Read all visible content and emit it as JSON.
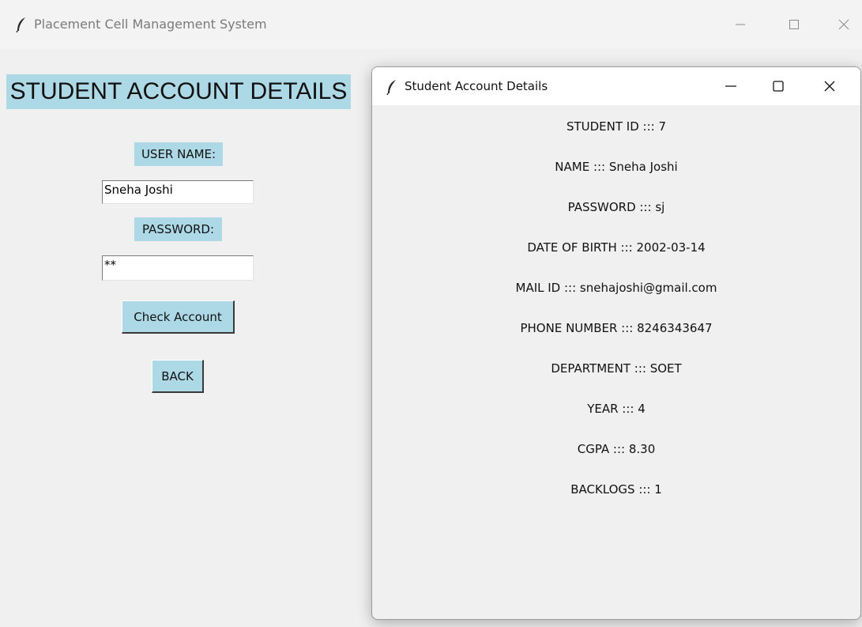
{
  "main_window": {
    "title": "Placement Cell Management System",
    "heading": "STUDENT ACCOUNT DETAILS",
    "username_label": "USER NAME:",
    "username_value": "Sneha Joshi",
    "password_label": "PASSWORD:",
    "password_value": "**",
    "check_account_label": "Check Account",
    "back_label": "BACK"
  },
  "popup_window": {
    "title": "Student Account Details",
    "details": [
      "STUDENT ID ::: 7",
      "NAME ::: Sneha Joshi",
      "PASSWORD ::: sj",
      "DATE OF BIRTH ::: 2002-03-14",
      "MAIL ID ::: snehajoshi@gmail.com",
      "PHONE NUMBER ::: 8246343647",
      "DEPARTMENT ::: SOET",
      "YEAR ::: 4",
      "CGPA ::: 8.30",
      "BACKLOGS ::: 1"
    ]
  },
  "icons": {
    "app": "feather-icon",
    "minimize": "minimize-icon",
    "maximize": "maximize-icon",
    "close": "close-icon"
  },
  "colors": {
    "label_background": "#add8e6",
    "window_background": "#f0f0f0"
  }
}
